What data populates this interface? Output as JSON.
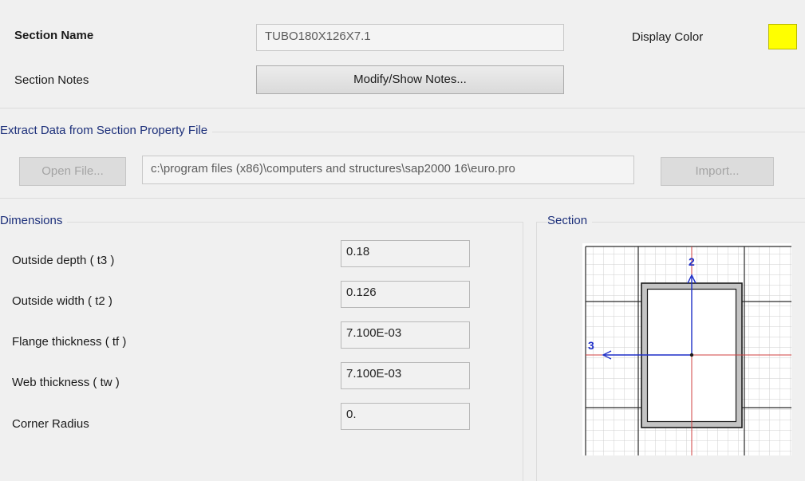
{
  "header": {
    "section_name_label": "Section Name",
    "section_name_value": "TUBO180X126X7.1",
    "display_color_label": "Display Color",
    "display_color": "#ffff00",
    "section_notes_label": "Section Notes",
    "modify_notes_button": "Modify/Show Notes..."
  },
  "extract": {
    "title": "Extract Data from Section Property File",
    "open_file_button": "Open File...",
    "file_path": "c:\\program files (x86)\\computers and structures\\sap2000 16\\euro.pro",
    "import_button": "Import..."
  },
  "dimensions": {
    "title": "Dimensions",
    "rows": [
      {
        "label": "Outside depth  ( t3 )",
        "value": "0.18"
      },
      {
        "label": "Outside width  ( t2 )",
        "value": "0.126"
      },
      {
        "label": "Flange thickness  ( tf )",
        "value": "7.100E-03"
      },
      {
        "label": "Web thickness  ( tw )",
        "value": "7.100E-03"
      },
      {
        "label": "Corner Radius",
        "value": "0."
      }
    ]
  },
  "section_preview": {
    "title": "Section",
    "axis_2_label": "2",
    "axis_3_label": "3",
    "section_fill_color": "#c8c8c8",
    "axis_color": "#2233cc",
    "centerline_color": "#d04040"
  }
}
